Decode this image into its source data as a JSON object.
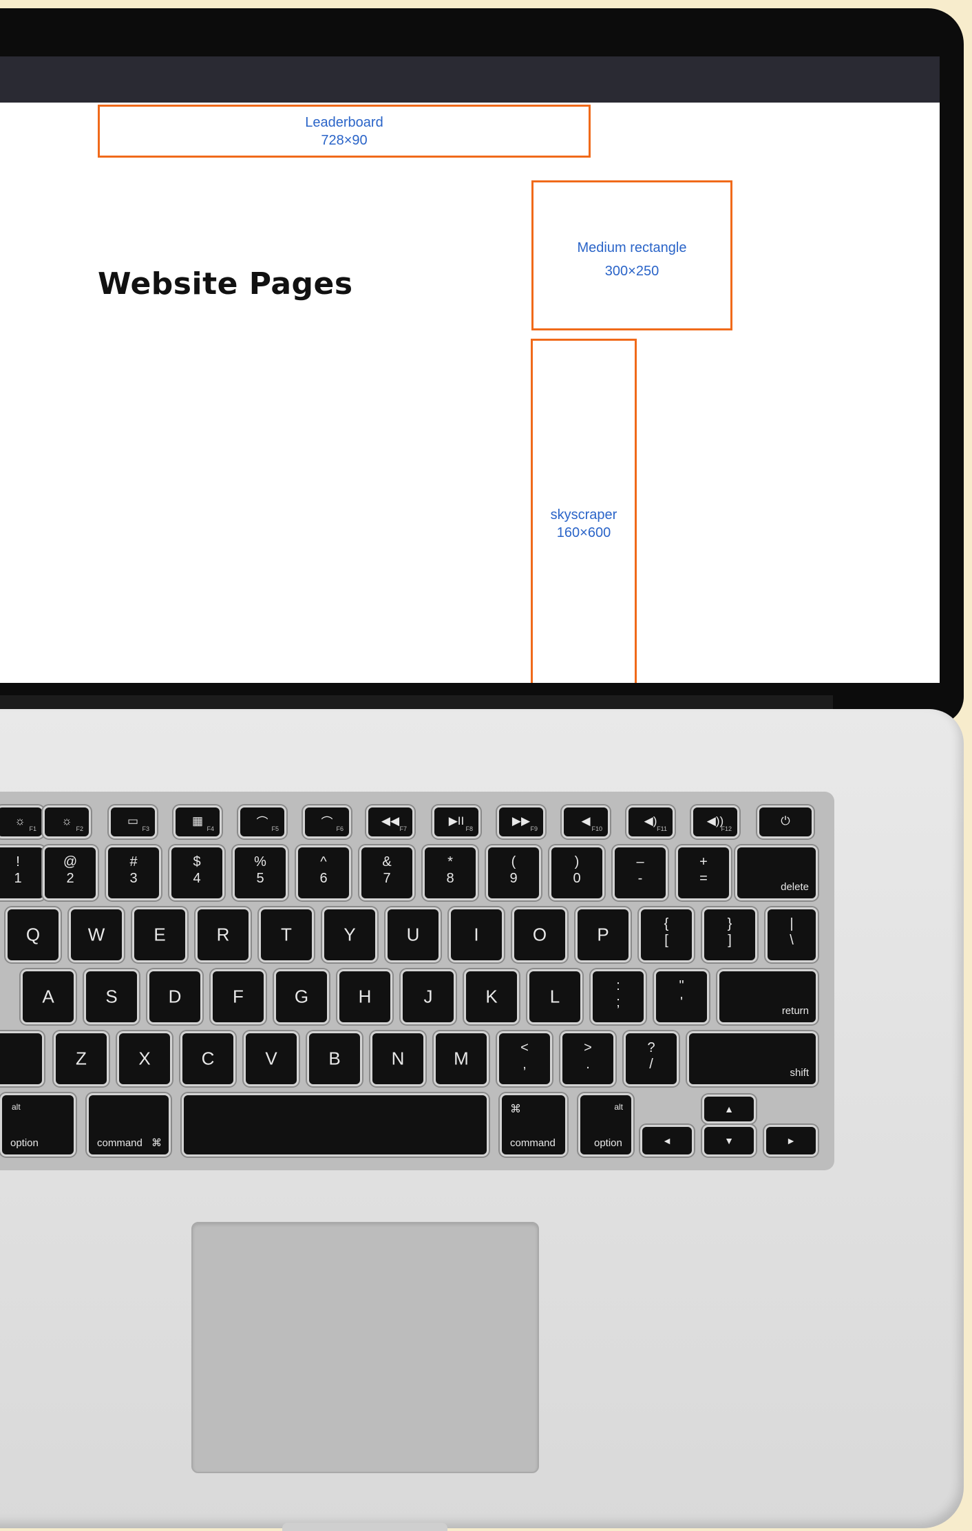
{
  "screen": {
    "heading": "Website Pages",
    "ads": {
      "leaderboard": {
        "name": "Leaderboard",
        "size": "728×90"
      },
      "medium_rectangle": {
        "name": "Medium rectangle",
        "size": "300×250"
      },
      "skyscraper": {
        "name": "skyscraper",
        "size": "160×600"
      }
    }
  },
  "keyboard": {
    "fn_row": [
      {
        "icon": "brightness-down-icon",
        "glyph": "☼",
        "fn": "F1"
      },
      {
        "icon": "brightness-up-icon",
        "glyph": "☼",
        "fn": "F2"
      },
      {
        "icon": "mission-control-icon",
        "glyph": "▭",
        "fn": "F3"
      },
      {
        "icon": "launchpad-icon",
        "glyph": "▦",
        "fn": "F4"
      },
      {
        "icon": "keyboard-light-down-icon",
        "glyph": "⌒",
        "fn": "F5"
      },
      {
        "icon": "keyboard-light-up-icon",
        "glyph": "⌒",
        "fn": "F6"
      },
      {
        "icon": "rewind-icon",
        "glyph": "◀◀",
        "fn": "F7"
      },
      {
        "icon": "play-pause-icon",
        "glyph": "▶II",
        "fn": "F8"
      },
      {
        "icon": "fast-forward-icon",
        "glyph": "▶▶",
        "fn": "F9"
      },
      {
        "icon": "mute-icon",
        "glyph": "◀",
        "fn": "F10"
      },
      {
        "icon": "volume-down-icon",
        "glyph": "◀)",
        "fn": "F11"
      },
      {
        "icon": "volume-up-icon",
        "glyph": "◀))",
        "fn": "F12"
      },
      {
        "icon": "power-icon",
        "glyph": "⏻",
        "fn": ""
      }
    ],
    "number_row": [
      {
        "up": "!",
        "dn": "1"
      },
      {
        "up": "@",
        "dn": "2"
      },
      {
        "up": "#",
        "dn": "3"
      },
      {
        "up": "$",
        "dn": "4"
      },
      {
        "up": "%",
        "dn": "5"
      },
      {
        "up": "^",
        "dn": "6"
      },
      {
        "up": "&",
        "dn": "7"
      },
      {
        "up": "*",
        "dn": "8"
      },
      {
        "up": "(",
        "dn": "9"
      },
      {
        "up": ")",
        "dn": "0"
      },
      {
        "up": "–",
        "dn": "-"
      },
      {
        "up": "+",
        "dn": "="
      }
    ],
    "delete": "delete",
    "qwerty_row": [
      "Q",
      "W",
      "E",
      "R",
      "T",
      "Y",
      "U",
      "I",
      "O",
      "P"
    ],
    "bracket_keys": [
      {
        "up": "{",
        "dn": "["
      },
      {
        "up": "}",
        "dn": "]"
      },
      {
        "up": "|",
        "dn": "\\"
      }
    ],
    "home_row": [
      "A",
      "S",
      "D",
      "F",
      "G",
      "H",
      "J",
      "K",
      "L"
    ],
    "home_punct": [
      {
        "up": ":",
        "dn": ";"
      },
      {
        "up": "\"",
        "dn": "'"
      }
    ],
    "return": "return",
    "bottom_row": [
      "Z",
      "X",
      "C",
      "V",
      "B",
      "N",
      "M"
    ],
    "bottom_punct": [
      {
        "up": "<",
        "dn": ","
      },
      {
        "up": ">",
        "dn": "."
      },
      {
        "up": "?",
        "dn": "/"
      }
    ],
    "shift": "shift",
    "alt": "alt",
    "option": "option",
    "command": "command",
    "command_symbol": "⌘",
    "arrows": {
      "left": "◄",
      "up": "▲",
      "down": "▼",
      "right": "►"
    }
  }
}
